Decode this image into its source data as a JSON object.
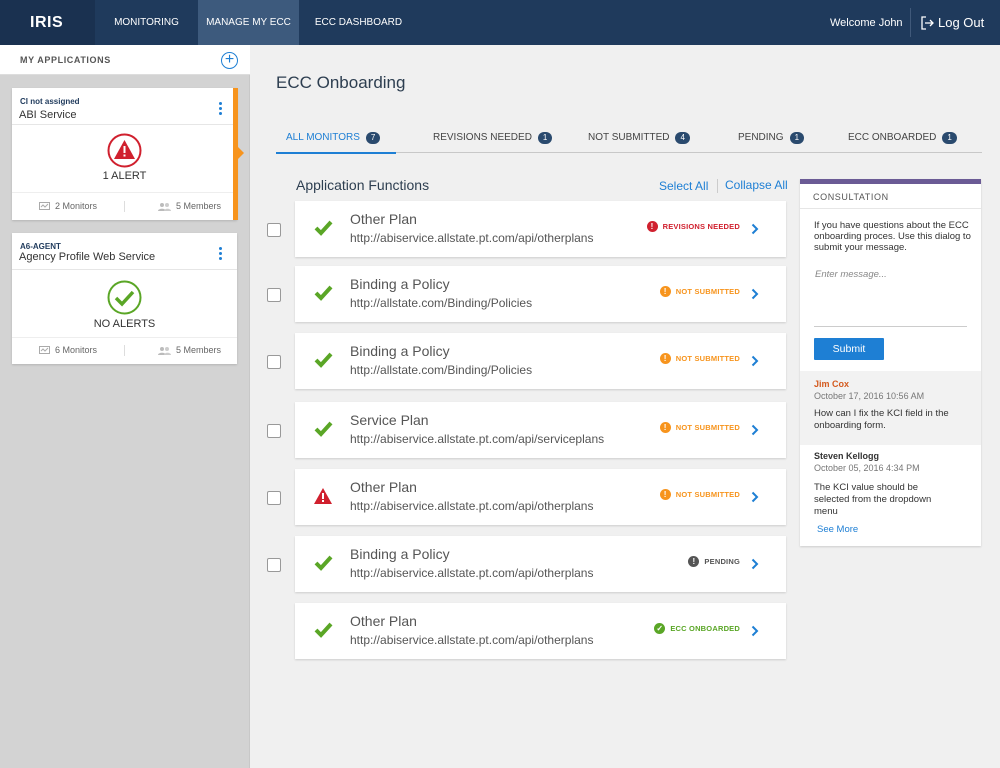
{
  "header": {
    "logo": "IRIS",
    "nav": [
      {
        "label": "MONITORING"
      },
      {
        "label": "MANAGE MY ECC"
      },
      {
        "label": "ECC DASHBOARD"
      }
    ],
    "welcome": "Welcome John",
    "logout": "Log Out"
  },
  "sidebar": {
    "title": "MY APPLICATIONS",
    "add_icon": "plus-circle-icon",
    "apps": [
      {
        "tag": "CI not assigned",
        "name": "ABI Service",
        "status": "1 ALERT",
        "status_icon": "alert-icon",
        "monitors": "2 Monitors",
        "members": "5 Members"
      },
      {
        "tag": "A6-AGENT",
        "name": "Agency Profile Web Service",
        "status": "NO ALERTS",
        "status_icon": "check-circle-icon",
        "monitors": "6 Monitors",
        "members": "5 Members"
      }
    ]
  },
  "main": {
    "title": "ECC Onboarding",
    "tabs": [
      {
        "label": "ALL MONITORS",
        "count": "7"
      },
      {
        "label": "REVISIONS NEEDED",
        "count": "1"
      },
      {
        "label": "NOT SUBMITTED",
        "count": "4"
      },
      {
        "label": "PENDING",
        "count": "1"
      },
      {
        "label": "ECC ONBOARDED",
        "count": "1"
      }
    ],
    "section_title": "Application Functions",
    "select_all": "Select All",
    "collapse_all": "Collapse All",
    "functions": [
      {
        "name": "Other Plan",
        "url": "http://abiservice.allstate.pt.com/api/otherplans",
        "status": "REVISIONS NEEDED",
        "icon": "check-icon"
      },
      {
        "name": "Binding a Policy",
        "url": "http://allstate.com/Binding/Policies",
        "status": "NOT SUBMITTED",
        "icon": "check-icon"
      },
      {
        "name": "Binding a Policy",
        "url": "http://allstate.com/Binding/Policies",
        "status": "NOT SUBMITTED",
        "icon": "check-icon"
      },
      {
        "name": "Service Plan",
        "url": "http://abiservice.allstate.pt.com/api/serviceplans",
        "status": "NOT SUBMITTED",
        "icon": "check-icon"
      },
      {
        "name": "Other Plan",
        "url": "http://abiservice.allstate.pt.com/api/otherplans",
        "status": "NOT SUBMITTED",
        "icon": "warning-icon"
      },
      {
        "name": "Binding a Policy",
        "url": "http://abiservice.allstate.pt.com/api/otherplans",
        "status": "PENDING",
        "icon": "check-icon"
      },
      {
        "name": "Other Plan",
        "url": "http://abiservice.allstate.pt.com/api/otherplans",
        "status": "ECC ONBOARDED",
        "icon": "check-icon"
      }
    ]
  },
  "consultation": {
    "title": "CONSULTATION",
    "description": "If you have questions about the ECC onboarding proces. Use this dialog to submit your message.",
    "placeholder": "Enter message...",
    "submit": "Submit",
    "messages": [
      {
        "author": "Jim Cox",
        "time": "October 17, 2016 10:56 AM",
        "body": "How can I fix the KCI field in the onboarding form."
      },
      {
        "author": "Steven Kellogg",
        "time": "October 05, 2016   4:34 PM",
        "body": "The KCI value should be selected from the dropdown menu"
      }
    ],
    "see_more": "See More"
  },
  "colors": {
    "nav": "#1f3a5c",
    "accent": "#1e7fd4",
    "revisions": "#d0202e",
    "not_submitted": "#f7941d",
    "pending": "#555555",
    "onboarded": "#5aa626"
  }
}
